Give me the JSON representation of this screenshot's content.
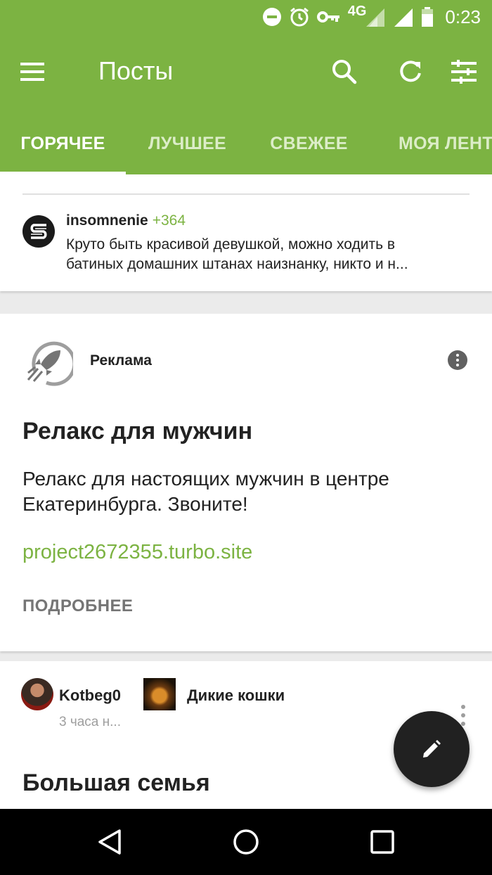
{
  "status_bar": {
    "time": "0:23",
    "network": "4G",
    "icons": [
      "do-not-disturb-icon",
      "alarm-icon",
      "vpn-key-icon",
      "signal-4g-icon",
      "signal-icon",
      "battery-icon"
    ]
  },
  "toolbar": {
    "title": "Посты",
    "icons": [
      "menu-icon",
      "search-icon",
      "refresh-icon",
      "filter-icon"
    ]
  },
  "tabs": [
    {
      "label": "ГОРЯЧЕЕ",
      "active": true
    },
    {
      "label": "ЛУЧШЕЕ",
      "active": false
    },
    {
      "label": "СВЕЖЕЕ",
      "active": false
    },
    {
      "label": "МОЯ ЛЕНТА",
      "active": false
    }
  ],
  "comment": {
    "username": "insomnenie",
    "rating": "+364",
    "text_line1": "Круто быть красивой девушкой, можно ходить в",
    "text_line2": "батиных домашних штанах наизнанку, никто и н..."
  },
  "ad": {
    "label": "Реклама",
    "title": "Релакс для мужчин",
    "text_line1": "Релакс для настоящих мужчин в центре",
    "text_line2": "Екатеринбурга. Звоните!",
    "link": "project2672355.turbo.site",
    "cta": "ПОДРОБНЕЕ"
  },
  "post": {
    "author": "Kotbeg0",
    "time": "3 часа н...",
    "community": "Дикие кошки",
    "title": "Большая семья"
  },
  "colors": {
    "brand": "#7cb342",
    "fab": "#212121",
    "navbar": "#000000"
  }
}
